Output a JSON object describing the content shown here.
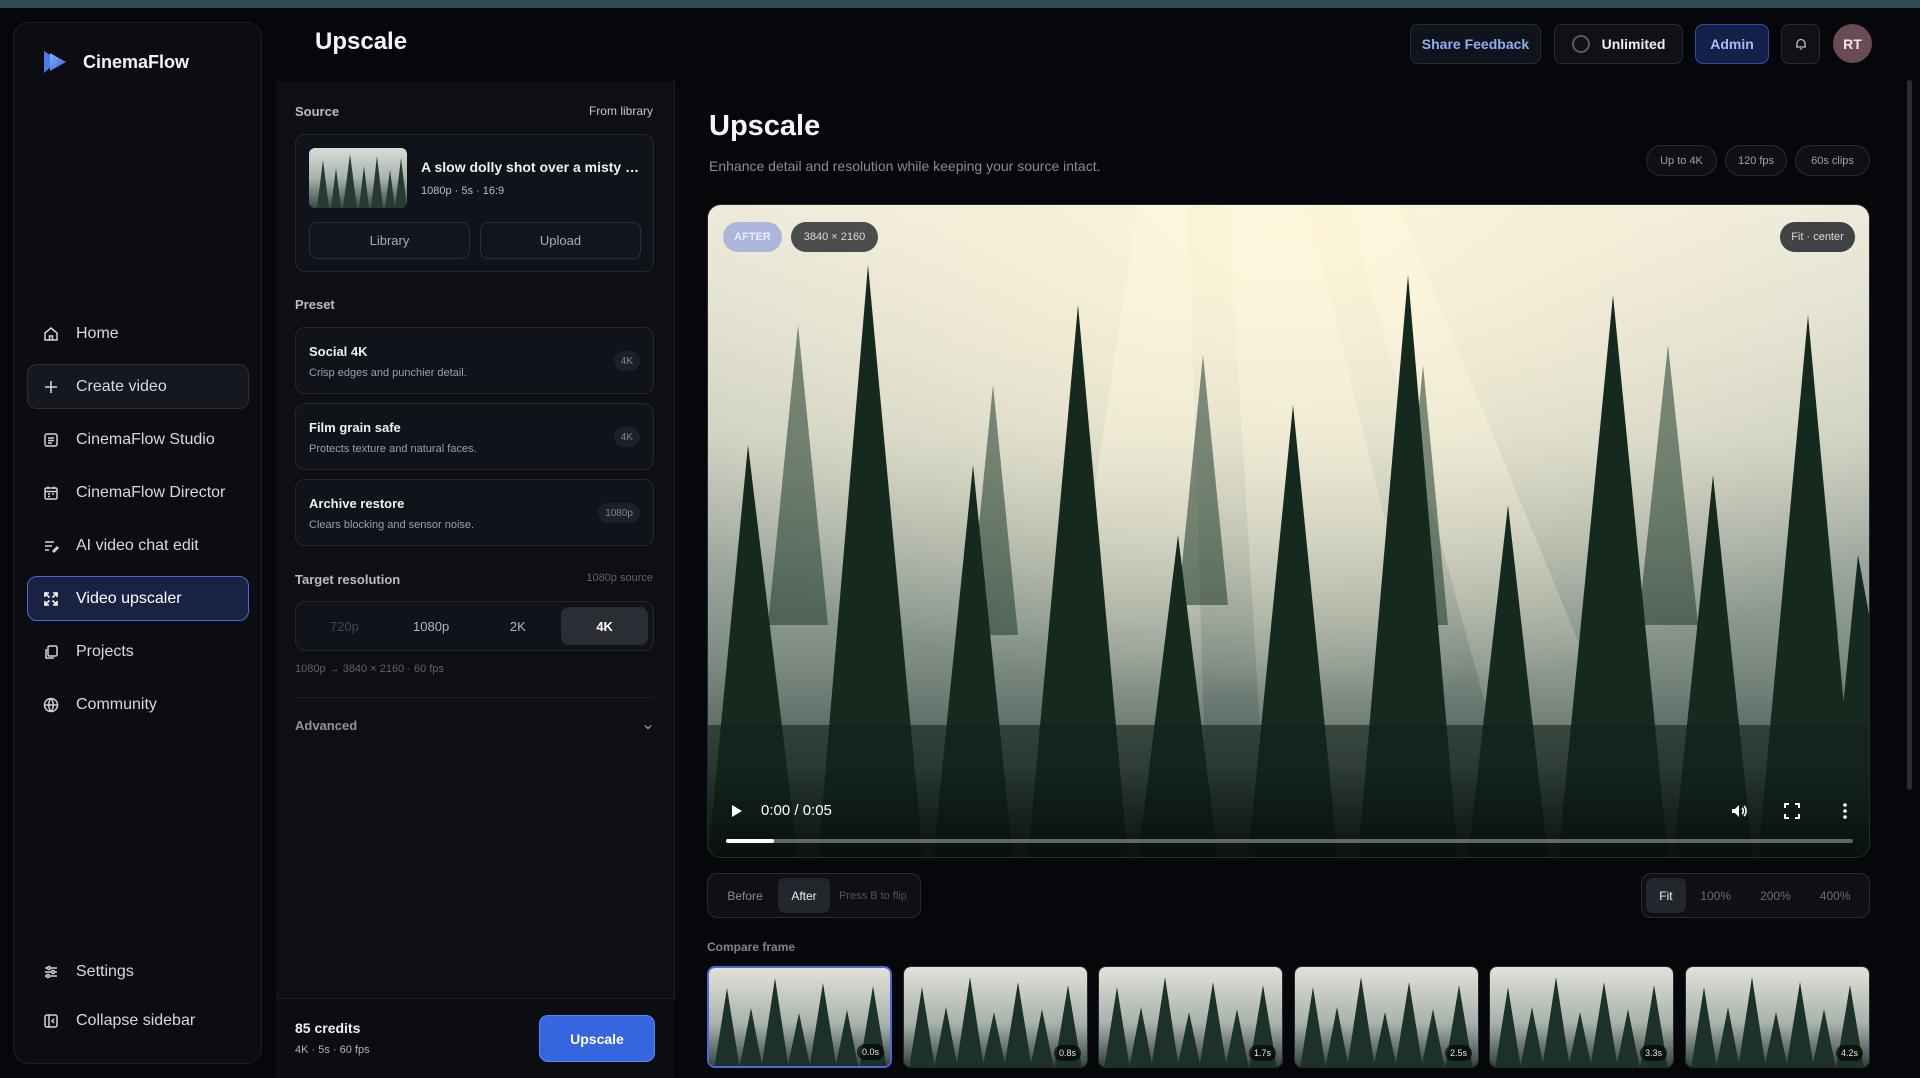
{
  "brand": {
    "name": "CinemaFlow"
  },
  "page": {
    "title": "Upscale"
  },
  "header": {
    "feedback": "Share Feedback",
    "plan": "Unlimited",
    "admin": "Admin",
    "avatar": "RT"
  },
  "sidebar": {
    "items": [
      {
        "label": "Home",
        "icon": "home-icon"
      },
      {
        "label": "Create video",
        "icon": "plus-icon"
      },
      {
        "label": "CinemaFlow Studio",
        "icon": "studio-icon"
      },
      {
        "label": "CinemaFlow Director",
        "icon": "calendar-icon"
      },
      {
        "label": "AI video chat edit",
        "icon": "chat-edit-icon"
      },
      {
        "label": "Video upscaler",
        "icon": "expand-icon"
      },
      {
        "label": "Projects",
        "icon": "copy-icon"
      },
      {
        "label": "Community",
        "icon": "globe-icon"
      }
    ],
    "bottom": [
      {
        "label": "Settings",
        "icon": "sliders-icon"
      },
      {
        "label": "Collapse sidebar",
        "icon": "collapse-icon"
      }
    ]
  },
  "source": {
    "label": "Source",
    "from": "From library",
    "title": "A slow dolly shot over a misty pine forest",
    "meta": "1080p · 5s · 16:9",
    "library": "Library",
    "upload": "Upload"
  },
  "preset": {
    "label": "Preset",
    "items": [
      {
        "title": "Social 4K",
        "desc": "Crisp edges and punchier detail.",
        "badge": "4K"
      },
      {
        "title": "Film grain safe",
        "desc": "Protects texture and natural faces.",
        "badge": "4K"
      },
      {
        "title": "Archive restore",
        "desc": "Clears blocking and sensor noise.",
        "badge": "1080p"
      }
    ]
  },
  "resolution": {
    "label": "Target resolution",
    "source": "1080p source",
    "options": [
      "720p",
      "1080p",
      "2K",
      "4K"
    ],
    "selected": "4K",
    "note": "1080p → 3840 × 2160 · 60 fps"
  },
  "advanced": {
    "label": "Advanced"
  },
  "footer": {
    "credits": "85 credits",
    "detail": "4K · 5s · 60 fps",
    "action": "Upscale"
  },
  "main": {
    "title": "Upscale",
    "subtitle": "Enhance detail and resolution while keeping your source intact.",
    "chips": [
      "Up to 4K",
      "120 fps",
      "60s clips"
    ]
  },
  "player": {
    "view": "AFTER",
    "dims": "3840 × 2160",
    "fit": "Fit · center",
    "time": "0:00 / 0:05",
    "progress": 0.043
  },
  "compare_toggle": {
    "before": "Before",
    "after": "After",
    "hint": "Press B to flip",
    "selected": "After"
  },
  "zoom": {
    "options": [
      "Fit",
      "100%",
      "200%",
      "400%"
    ],
    "selected": "Fit"
  },
  "compare": {
    "label": "Compare frame",
    "frames": [
      "0.0s",
      "0.8s",
      "1.7s",
      "2.5s",
      "3.3s",
      "4.2s"
    ],
    "selected": 0
  }
}
